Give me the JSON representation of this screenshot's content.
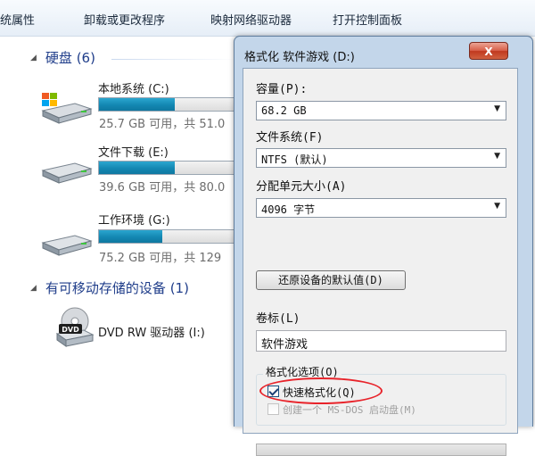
{
  "toolbar": {
    "items": [
      "统属性",
      "卸载或更改程序",
      "映射网络驱动器",
      "打开控制面板"
    ]
  },
  "groups": {
    "hard_disks": {
      "label": "硬盘 (6)"
    },
    "removable": {
      "label": "有可移动存储的设备 (1)"
    }
  },
  "drives": [
    {
      "name": "本地系统 (C:)",
      "space": "25.7 GB 可用，共 51.0",
      "used_fraction": 0.5
    },
    {
      "name": "文件下载 (E:)",
      "space": "39.6 GB 可用，共 80.0",
      "used_fraction": 0.5
    },
    {
      "name": "工作环境 (G:)",
      "space": "75.2 GB 可用，共 129",
      "used_fraction": 0.42
    }
  ],
  "dvd": {
    "name": "DVD RW 驱动器 (I:)",
    "badge": "DVD"
  },
  "dialog": {
    "title": "格式化 软件游戏 (D:)",
    "close_label": "X",
    "capacity_label": "容量(P):",
    "capacity_value": "68.2 GB",
    "fs_label": "文件系统(F)",
    "fs_value": "NTFS (默认)",
    "alloc_label": "分配单元大小(A)",
    "alloc_value": "4096 字节",
    "restore_button": "还原设备的默认值(D)",
    "volume_label": "卷标(L)",
    "volume_value": "软件游戏",
    "options_title": "格式化选项(O)",
    "quick_format_label": "快速格式化(Q)",
    "quick_format_checked": true,
    "msdos_label": "创建一个 MS-DOS 启动盘(M)",
    "msdos_checked": false
  },
  "colors": {
    "highlight_ring": "#e8232a",
    "drive_bar": "#1387b2"
  }
}
